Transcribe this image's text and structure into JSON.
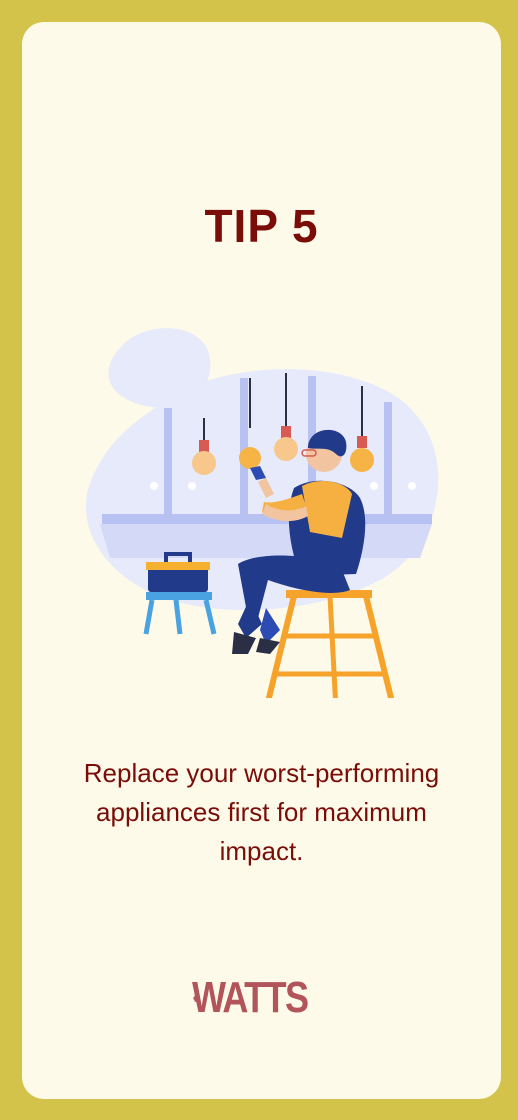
{
  "tip": {
    "title": "TIP 5",
    "description": "Replace your worst-performing appliances first for maximum impact."
  },
  "illustration": {
    "name": "electrician-changing-lightbulb"
  },
  "brand": {
    "logo_text": "WATTS",
    "logo_icon": "lightbulb-icon",
    "color": "#b2555a"
  },
  "colors": {
    "frame": "#d4c34a",
    "card": "#fdfae9",
    "title": "#7a0d08"
  }
}
